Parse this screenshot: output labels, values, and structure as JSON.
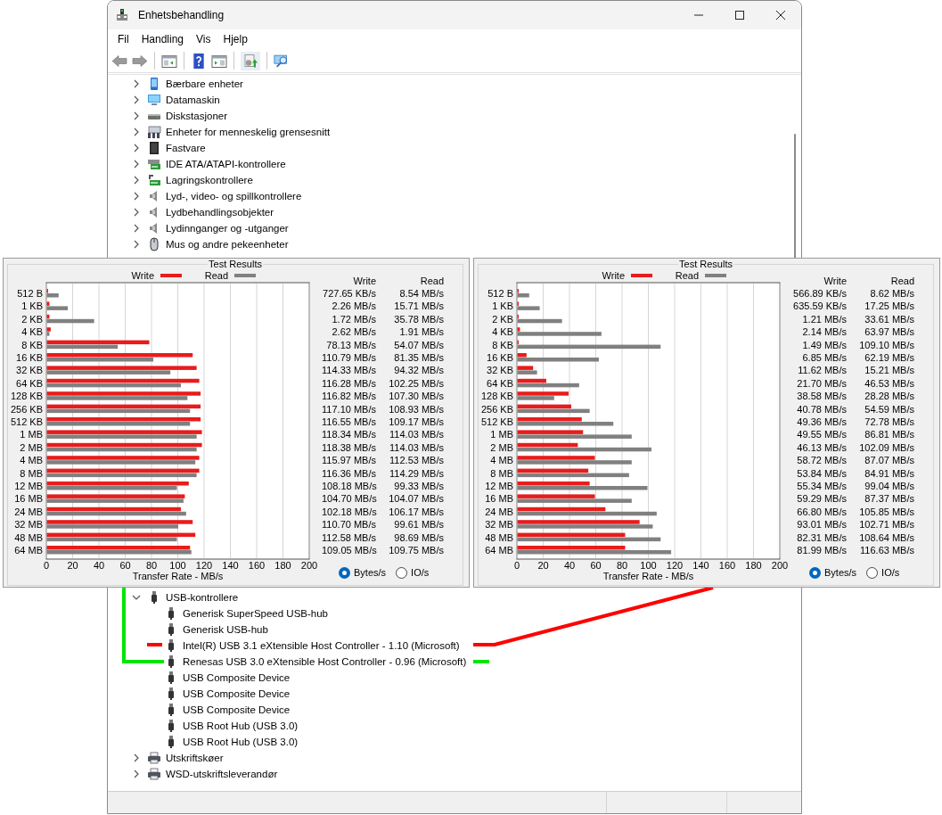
{
  "window": {
    "title": "Enhetsbehandling"
  },
  "menu": [
    {
      "label": "Fil"
    },
    {
      "label": "Handling"
    },
    {
      "label": "Vis"
    },
    {
      "label": "Hjelp"
    }
  ],
  "toolbar": [
    {
      "kind": "back",
      "disabled": true
    },
    {
      "kind": "forward",
      "disabled": true
    },
    {
      "kind": "separator"
    },
    {
      "kind": "console"
    },
    {
      "kind": "separator"
    },
    {
      "kind": "help"
    },
    {
      "kind": "pane"
    },
    {
      "kind": "separator"
    },
    {
      "kind": "update"
    },
    {
      "kind": "separator"
    },
    {
      "kind": "scan"
    }
  ],
  "tree_upper": [
    {
      "label": "Bærbare enheter",
      "kind": "portable",
      "expanded": false
    },
    {
      "label": "Datamaskin",
      "kind": "computer",
      "expanded": false
    },
    {
      "label": "Diskstasjoner",
      "kind": "disk",
      "expanded": false
    },
    {
      "label": "Enheter for menneskelig grensesnitt",
      "kind": "hid",
      "expanded": false
    },
    {
      "label": "Fastvare",
      "kind": "firmware",
      "expanded": false
    },
    {
      "label": "IDE ATA/ATAPI-kontrollere",
      "kind": "ide",
      "expanded": false
    },
    {
      "label": "Lagringskontrollere",
      "kind": "storage",
      "expanded": false
    },
    {
      "label": "Lyd-, video- og spillkontrollere",
      "kind": "sound",
      "expanded": false
    },
    {
      "label": "Lydbehandlingsobjekter",
      "kind": "sound",
      "expanded": false
    },
    {
      "label": "Lydinnganger og -utganger",
      "kind": "sound",
      "expanded": false
    },
    {
      "label": "Mus og andre pekeenheter",
      "kind": "mouse",
      "expanded": false
    }
  ],
  "tree_lower": [
    {
      "label": "USB-kontrollere",
      "kind": "usb",
      "expanded": true,
      "children": [
        {
          "label": "Generisk SuperSpeed USB-hub",
          "kind": "usb"
        },
        {
          "label": "Generisk USB-hub",
          "kind": "usb"
        },
        {
          "label": "Intel(R) USB 3.1 eXtensible Host Controller - 1.10 (Microsoft)",
          "kind": "usb",
          "color": "#ff0000"
        },
        {
          "label": "Renesas USB 3.0 eXtensible Host Controller - 0.96 (Microsoft)",
          "kind": "usb",
          "color": "#00e600"
        },
        {
          "label": "USB Composite Device",
          "kind": "usb"
        },
        {
          "label": "USB Composite Device",
          "kind": "usb"
        },
        {
          "label": "USB Composite Device",
          "kind": "usb"
        },
        {
          "label": "USB Root Hub (USB 3.0)",
          "kind": "usb"
        },
        {
          "label": "USB Root Hub (USB 3.0)",
          "kind": "usb"
        }
      ]
    },
    {
      "label": "Utskriftskøer",
      "kind": "printer",
      "expanded": false
    },
    {
      "label": "WSD-utskriftsleverandør",
      "kind": "printer",
      "expanded": false
    }
  ],
  "benchmarks": [
    {
      "chart_data": {
        "type": "bar",
        "orientation": "horizontal",
        "title": "Test Results",
        "xlabel": "Transfer Rate - MB/s",
        "xlim": [
          0,
          200
        ],
        "xticks": [
          0,
          20,
          40,
          60,
          80,
          100,
          120,
          140,
          160,
          180,
          200
        ],
        "grid": true,
        "legend": "top",
        "categories": [
          "512 B",
          "1 KB",
          "2 KB",
          "4 KB",
          "8 KB",
          "16 KB",
          "32 KB",
          "64 KB",
          "128 KB",
          "256 KB",
          "512 KB",
          "1 MB",
          "2 MB",
          "4 MB",
          "8 MB",
          "12 MB",
          "16 MB",
          "24 MB",
          "32 MB",
          "48 MB",
          "64 MB"
        ],
        "series": [
          {
            "name": "Write",
            "color": "#e81c1c",
            "values": [
              1,
              2,
              2,
              3,
              78,
              111,
              114,
              116,
              117,
              117,
              117,
              118,
              118,
              116,
              116,
              108,
              105,
              102,
              111,
              113,
              109
            ]
          },
          {
            "name": "Read",
            "color": "#808080",
            "values": [
              9,
              16,
              36,
              2,
              54,
              81,
              94,
              102,
              107,
              109,
              109,
              114,
              114,
              113,
              114,
              99,
              104,
              106,
              100,
              99,
              110
            ]
          }
        ]
      },
      "table": {
        "columns": [
          "Write",
          "Read"
        ],
        "rows": [
          [
            "727.65 KB/s",
            "8.54 MB/s"
          ],
          [
            "2.26 MB/s",
            "15.71 MB/s"
          ],
          [
            "1.72 MB/s",
            "35.78 MB/s"
          ],
          [
            "2.62 MB/s",
            "1.91 MB/s"
          ],
          [
            "78.13 MB/s",
            "54.07 MB/s"
          ],
          [
            "110.79 MB/s",
            "81.35 MB/s"
          ],
          [
            "114.33 MB/s",
            "94.32 MB/s"
          ],
          [
            "116.28 MB/s",
            "102.25 MB/s"
          ],
          [
            "116.82 MB/s",
            "107.30 MB/s"
          ],
          [
            "117.10 MB/s",
            "108.93 MB/s"
          ],
          [
            "116.55 MB/s",
            "109.17 MB/s"
          ],
          [
            "118.34 MB/s",
            "114.03 MB/s"
          ],
          [
            "118.38 MB/s",
            "114.03 MB/s"
          ],
          [
            "115.97 MB/s",
            "112.53 MB/s"
          ],
          [
            "116.36 MB/s",
            "114.29 MB/s"
          ],
          [
            "108.18 MB/s",
            "99.33 MB/s"
          ],
          [
            "104.70 MB/s",
            "104.07 MB/s"
          ],
          [
            "102.18 MB/s",
            "106.17 MB/s"
          ],
          [
            "110.70 MB/s",
            "99.61 MB/s"
          ],
          [
            "112.58 MB/s",
            "98.69 MB/s"
          ],
          [
            "109.05 MB/s",
            "109.75 MB/s"
          ]
        ]
      },
      "units": [
        {
          "label": "Bytes/s",
          "selected": true
        },
        {
          "label": "IO/s",
          "selected": false
        }
      ]
    },
    {
      "chart_data": {
        "type": "bar",
        "orientation": "horizontal",
        "title": "Test Results",
        "xlabel": "Transfer Rate - MB/s",
        "xlim": [
          0,
          200
        ],
        "xticks": [
          0,
          20,
          40,
          60,
          80,
          100,
          120,
          140,
          160,
          180,
          200
        ],
        "grid": true,
        "legend": "top",
        "categories": [
          "512 B",
          "1 KB",
          "2 KB",
          "4 KB",
          "8 KB",
          "16 KB",
          "32 KB",
          "64 KB",
          "128 KB",
          "256 KB",
          "512 KB",
          "1 MB",
          "2 MB",
          "4 MB",
          "8 MB",
          "12 MB",
          "16 MB",
          "24 MB",
          "32 MB",
          "48 MB",
          "64 MB"
        ],
        "series": [
          {
            "name": "Write",
            "color": "#e81c1c",
            "values": [
              1,
              1,
              1,
              2,
              1,
              7,
              12,
              22,
              39,
              41,
              49,
              50,
              46,
              59,
              54,
              55,
              59,
              67,
              93,
              82,
              82
            ]
          },
          {
            "name": "Read",
            "color": "#808080",
            "values": [
              9,
              17,
              34,
              64,
              109,
              62,
              15,
              47,
              28,
              55,
              73,
              87,
              102,
              87,
              85,
              99,
              87,
              106,
              103,
              109,
              117
            ]
          }
        ]
      },
      "table": {
        "columns": [
          "Write",
          "Read"
        ],
        "rows": [
          [
            "566.89 KB/s",
            "8.62 MB/s"
          ],
          [
            "635.59 KB/s",
            "17.25 MB/s"
          ],
          [
            "1.21 MB/s",
            "33.61 MB/s"
          ],
          [
            "2.14 MB/s",
            "63.97 MB/s"
          ],
          [
            "1.49 MB/s",
            "109.10 MB/s"
          ],
          [
            "6.85 MB/s",
            "62.19 MB/s"
          ],
          [
            "11.62 MB/s",
            "15.21 MB/s"
          ],
          [
            "21.70 MB/s",
            "46.53 MB/s"
          ],
          [
            "38.58 MB/s",
            "28.28 MB/s"
          ],
          [
            "40.78 MB/s",
            "54.59 MB/s"
          ],
          [
            "49.36 MB/s",
            "72.78 MB/s"
          ],
          [
            "49.55 MB/s",
            "86.81 MB/s"
          ],
          [
            "46.13 MB/s",
            "102.09 MB/s"
          ],
          [
            "58.72 MB/s",
            "87.07 MB/s"
          ],
          [
            "53.84 MB/s",
            "84.91 MB/s"
          ],
          [
            "55.34 MB/s",
            "99.04 MB/s"
          ],
          [
            "59.29 MB/s",
            "87.37 MB/s"
          ],
          [
            "66.80 MB/s",
            "105.85 MB/s"
          ],
          [
            "93.01 MB/s",
            "102.71 MB/s"
          ],
          [
            "82.31 MB/s",
            "108.64 MB/s"
          ],
          [
            "81.99 MB/s",
            "116.63 MB/s"
          ]
        ]
      },
      "units": [
        {
          "label": "Bytes/s",
          "selected": true
        },
        {
          "label": "IO/s",
          "selected": false
        }
      ]
    }
  ]
}
